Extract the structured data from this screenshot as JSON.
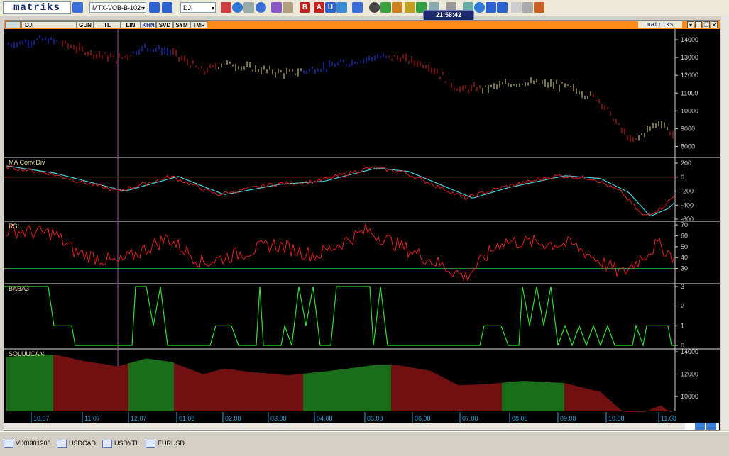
{
  "toolbar": {
    "logo": "matriks",
    "workspace": "MTX-VOB-B-102‹",
    "symbol": "DJI",
    "clock": "21:58:42"
  },
  "chart_window": {
    "symbol_label": "DJI",
    "tabs": [
      "GUN",
      "TL",
      "LIN",
      "KHN",
      "SVD",
      "SYM",
      "TMP"
    ],
    "active_tab": "KHN",
    "brand": "matriks"
  },
  "panels": {
    "price": {
      "yticks": [
        "14000",
        "13000",
        "12000",
        "11000",
        "10000",
        "9000",
        "8000"
      ]
    },
    "ma": {
      "label": "MA Conv.Div",
      "yticks": [
        "200",
        "0",
        "-200",
        "-400",
        "-600"
      ]
    },
    "rsi": {
      "label": "RSI",
      "yticks": [
        "70",
        "60",
        "50",
        "40",
        "30"
      ]
    },
    "baba": {
      "label": "BABA3",
      "yticks": [
        "3",
        "2",
        "1",
        "0"
      ]
    },
    "soluucan": {
      "label": "SOLUUCAN",
      "yticks": [
        "14000",
        "12000",
        "10000"
      ]
    }
  },
  "xaxis": {
    "labels": [
      "10.07",
      "11.07",
      "12.07",
      "01.08",
      "02.08",
      "03.08",
      "04.08",
      "05.08",
      "06.08",
      "07.08",
      "08.08",
      "09.08",
      "10.08",
      "11.08"
    ]
  },
  "bottom_tabs": [
    "VIX0301208.",
    "USDCAD.",
    "USDYTL.",
    "EURUSD."
  ],
  "colors": {
    "up": "#2340ff",
    "down": "#e02020",
    "neutral": "#f0e68c",
    "signal": "#33dd33",
    "ma_fast": "#e02020",
    "ma_slow": "#40d0e0"
  }
}
